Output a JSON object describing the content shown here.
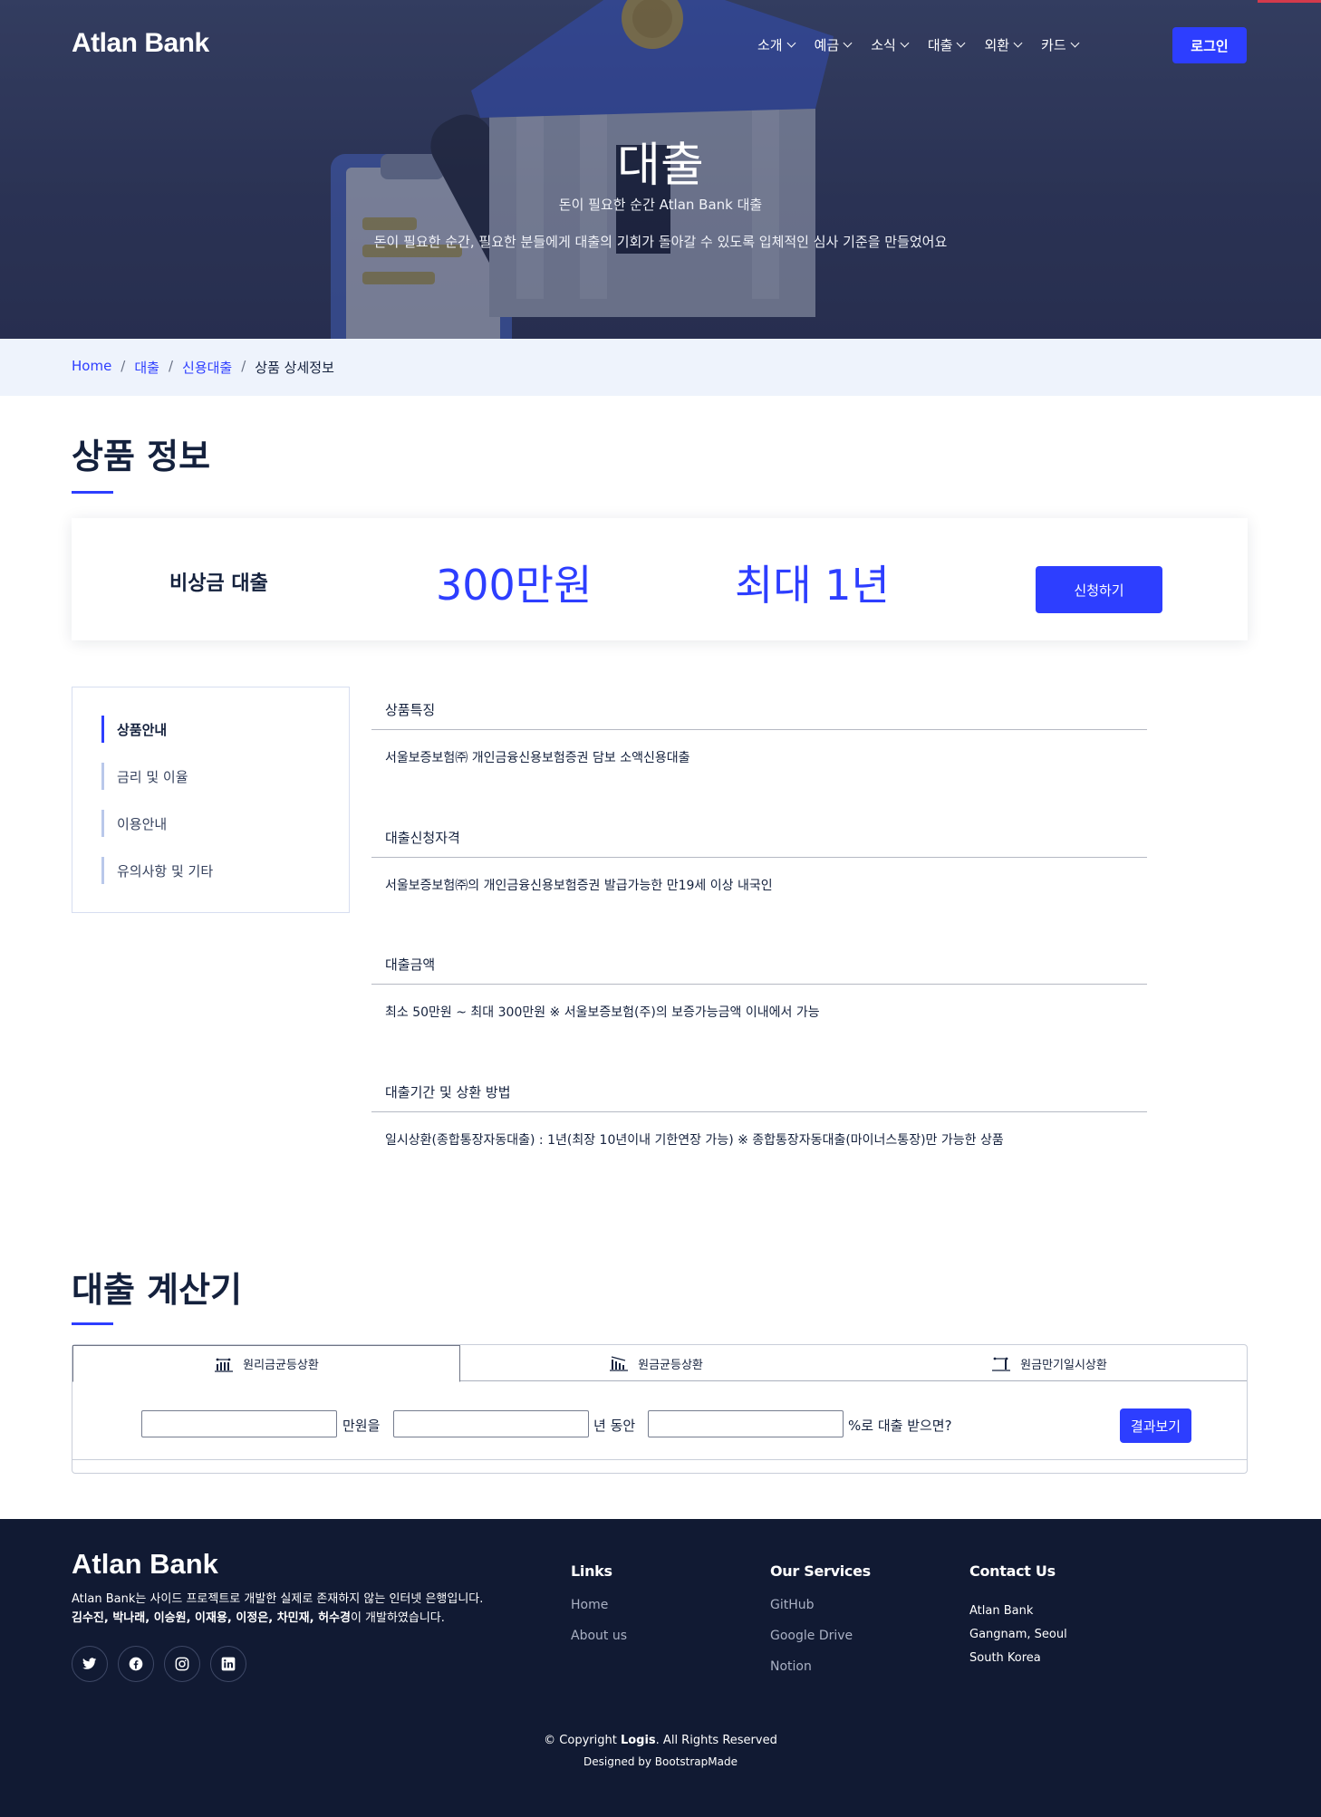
{
  "header": {
    "logo": "Atlan Bank",
    "nav": [
      {
        "label": "소개"
      },
      {
        "label": "예금"
      },
      {
        "label": "소식"
      },
      {
        "label": "대출"
      },
      {
        "label": "외환"
      },
      {
        "label": "카드"
      }
    ],
    "login_label": "로그인"
  },
  "hero": {
    "title": "대출",
    "subtitle": "돈이 필요한 순간 Atlan Bank 대출",
    "description": "돈이 필요한 순간, 필요한 분들에게 대출의 기회가 돌아갈 수 있도록 입체적인 심사 기준을 만들었어요"
  },
  "breadcrumb": {
    "items": [
      "Home",
      "대출",
      "신용대출"
    ],
    "current": "상품 상세정보"
  },
  "product_section": {
    "title": "상품 정보",
    "card": {
      "name": "비상금 대출",
      "amount": "300만원",
      "term": "최대 1년",
      "apply_label": "신청하기"
    }
  },
  "side_menu": {
    "items": [
      {
        "label": "상품안내",
        "active": true
      },
      {
        "label": "금리 및 이율",
        "active": false
      },
      {
        "label": "이용안내",
        "active": false
      },
      {
        "label": "유의사항 및 기타",
        "active": false
      }
    ]
  },
  "details": [
    {
      "heading": "상품특징",
      "body": "서울보증보험㈜ 개인금융신용보험증권 담보 소액신용대출"
    },
    {
      "heading": "대출신청자격",
      "body": "서울보증보험㈜의 개인금융신용보험증권 발급가능한 만19세 이상 내국인"
    },
    {
      "heading": "대출금액",
      "body": "최소 50만원 ~ 최대 300만원 ※ 서울보증보험(주)의 보증가능금액 이내에서 가능"
    },
    {
      "heading": "대출기간 및 상환 방법",
      "body": "일시상환(종합통장자동대출) : 1년(최장 10년이내 기한연장 가능) ※ 종합통장자동대출(마이너스통장)만 가능한 상품"
    }
  ],
  "calculator": {
    "title": "대출 계산기",
    "tabs": [
      {
        "label": "원리금균등상환",
        "active": true
      },
      {
        "label": "원금균등상환",
        "active": false
      },
      {
        "label": "원금만기일시상환",
        "active": false
      }
    ],
    "labels": {
      "amount_suffix": "만원을",
      "years_suffix": "년 동안",
      "rate_suffix": "%로 대출 받으면?"
    },
    "inputs": {
      "amount": "",
      "years": "",
      "rate": ""
    },
    "submit_label": "결과보기"
  },
  "footer": {
    "logo": "Atlan Bank",
    "description": "Atlan Bank는 사이드 프로젝트로 개발한 실제로 존재하지 않는 인터넷 은행입니다.",
    "team_names": "김수진, 박나래, 이승원, 이재용, 이정은, 차민재, 허수경",
    "team_suffix": "이 개발하였습니다.",
    "socials": [
      "twitter-icon",
      "facebook-icon",
      "instagram-icon",
      "linkedin-icon"
    ],
    "links": {
      "title": "Links",
      "items": [
        "Home",
        "About us"
      ]
    },
    "services": {
      "title": "Our Services",
      "items": [
        "GitHub",
        "Google Drive",
        "Notion"
      ]
    },
    "contact": {
      "title": "Contact Us",
      "lines": [
        "Atlan Bank",
        "Gangnam, Seoul",
        "South Korea"
      ]
    },
    "copyright_prefix": "© Copyright ",
    "copyright_brand": "Logis",
    "copyright_suffix": ". All Rights Reserved",
    "designed_by": "Designed by BootstrapMade"
  },
  "colors": {
    "accent": "#2d3eff",
    "navy": "#14213d",
    "footer_bg": "#111a33",
    "breadcrumb_bg": "#eef3fc"
  }
}
